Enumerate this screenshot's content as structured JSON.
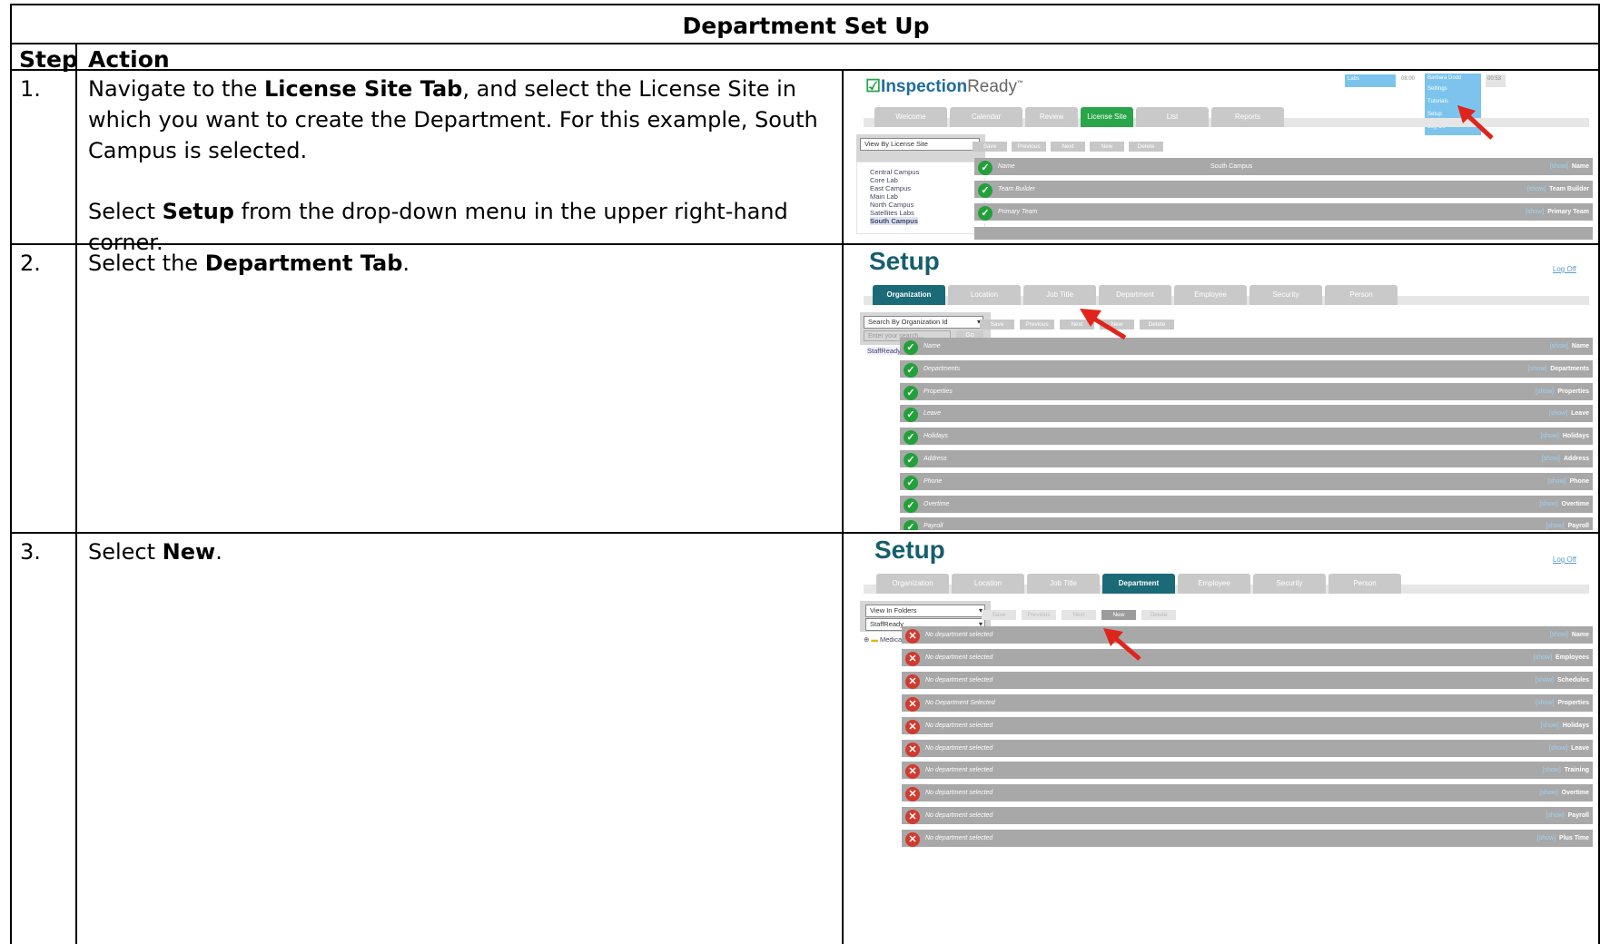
{
  "document": {
    "title": "Department Set Up",
    "header_step": "Step",
    "header_action": "Action"
  },
  "steps": [
    {
      "num": "1.",
      "p1_a": "Navigate to the ",
      "p1_b": "License Site Tab",
      "p1_c": ", and select the License Site in which you want to create the Department. For this example, South Campus is selected.",
      "p2_a": "Select ",
      "p2_b": "Setup",
      "p2_c": " from the drop-down menu in the upper right-hand corner."
    },
    {
      "num": "2.",
      "p1_a": "Select the ",
      "p1_b": "Department Tab",
      "p1_c": "."
    },
    {
      "num": "3.",
      "p1_a": "Select ",
      "p1_b": "New",
      "p1_c": "."
    }
  ],
  "shot1": {
    "logo_check": "☑",
    "logo_a": "Inspection",
    "logo_b": "Ready",
    "logo_tm": "™",
    "top_field": "Labs",
    "time1": "08:00",
    "user": "Barbara Dodd",
    "time2": "00:53",
    "menu": [
      "Settings",
      "Tutorials",
      "Setup",
      "Log Off"
    ],
    "tabs": [
      "Welcome",
      "Calendar",
      "Review",
      "License Site",
      "List",
      "Reports"
    ],
    "select": "View By License Site",
    "tree": [
      "Central Campus",
      "Core Lab",
      "East Campus",
      "Main Lab",
      "North Campus",
      "Satellites Labs",
      "South Campus"
    ],
    "buttons": [
      "Save",
      "Previous",
      "Next",
      "New",
      "Delete"
    ],
    "rows": [
      {
        "label": "Name",
        "value": "South Campus",
        "show": "[show]",
        "right": "Name"
      },
      {
        "label": "Team Builder",
        "value": "",
        "show": "[show]",
        "right": "Team Builder"
      },
      {
        "label": "Primary Team",
        "value": "",
        "show": "[show]",
        "right": "Primary Team"
      }
    ]
  },
  "shot2": {
    "title": "Setup",
    "logoff": "Log Off",
    "tabs": [
      "Organization",
      "Location",
      "Job Title",
      "Department",
      "Employee",
      "Security",
      "Person"
    ],
    "select": "Search By Organization Id",
    "search_placeholder": "Enter your search...",
    "go": "Go",
    "tree": [
      "StaffReady"
    ],
    "buttons": [
      "Save",
      "Previous",
      "Next",
      "New",
      "Delete"
    ],
    "rows": [
      {
        "label": "Name",
        "show": "[show]",
        "right": "Name"
      },
      {
        "label": "Departments",
        "show": "[show]",
        "right": "Departments"
      },
      {
        "label": "Properties",
        "show": "[show]",
        "right": "Properties"
      },
      {
        "label": "Leave",
        "show": "[show]",
        "right": "Leave"
      },
      {
        "label": "Holidays",
        "show": "[show]",
        "right": "Holidays"
      },
      {
        "label": "Address",
        "show": "[show]",
        "right": "Address"
      },
      {
        "label": "Phone",
        "show": "[show]",
        "right": "Phone"
      },
      {
        "label": "Overtime",
        "show": "[show]",
        "right": "Overtime"
      },
      {
        "label": "Payroll",
        "show": "[show]",
        "right": "Payroll"
      }
    ]
  },
  "shot3": {
    "title": "Setup",
    "logoff": "Log Off",
    "tabs": [
      "Organization",
      "Location",
      "Job Title",
      "Department",
      "Employee",
      "Security",
      "Person"
    ],
    "select1": "View In Folders",
    "select2": "StaffReady",
    "tree": [
      "Medical Center"
    ],
    "buttons": [
      "Save",
      "Previous",
      "Next",
      "New",
      "Delete"
    ],
    "rows": [
      {
        "label": "No department selected",
        "show": "[show]",
        "right": "Name"
      },
      {
        "label": "No department selected",
        "show": "[show]",
        "right": "Employees"
      },
      {
        "label": "No department selected",
        "show": "[show]",
        "right": "Schedules"
      },
      {
        "label": "No Department Selected",
        "show": "[show]",
        "right": "Properties"
      },
      {
        "label": "No department selected",
        "show": "[show]",
        "right": "Holidays"
      },
      {
        "label": "No department selected",
        "show": "[show]",
        "right": "Leave"
      },
      {
        "label": "No department selected",
        "show": "[show]",
        "right": "Training"
      },
      {
        "label": "No department selected",
        "show": "[show]",
        "right": "Overtime"
      },
      {
        "label": "No department selected",
        "show": "[show]",
        "right": "Payroll"
      },
      {
        "label": "No department selected",
        "show": "[show]",
        "right": "Plus Time"
      }
    ]
  },
  "colors": {
    "setup_teal": "#165e6c",
    "check_green": "#22a03a",
    "error_red": "#d23a2f",
    "arrow_red": "#e0241b"
  }
}
